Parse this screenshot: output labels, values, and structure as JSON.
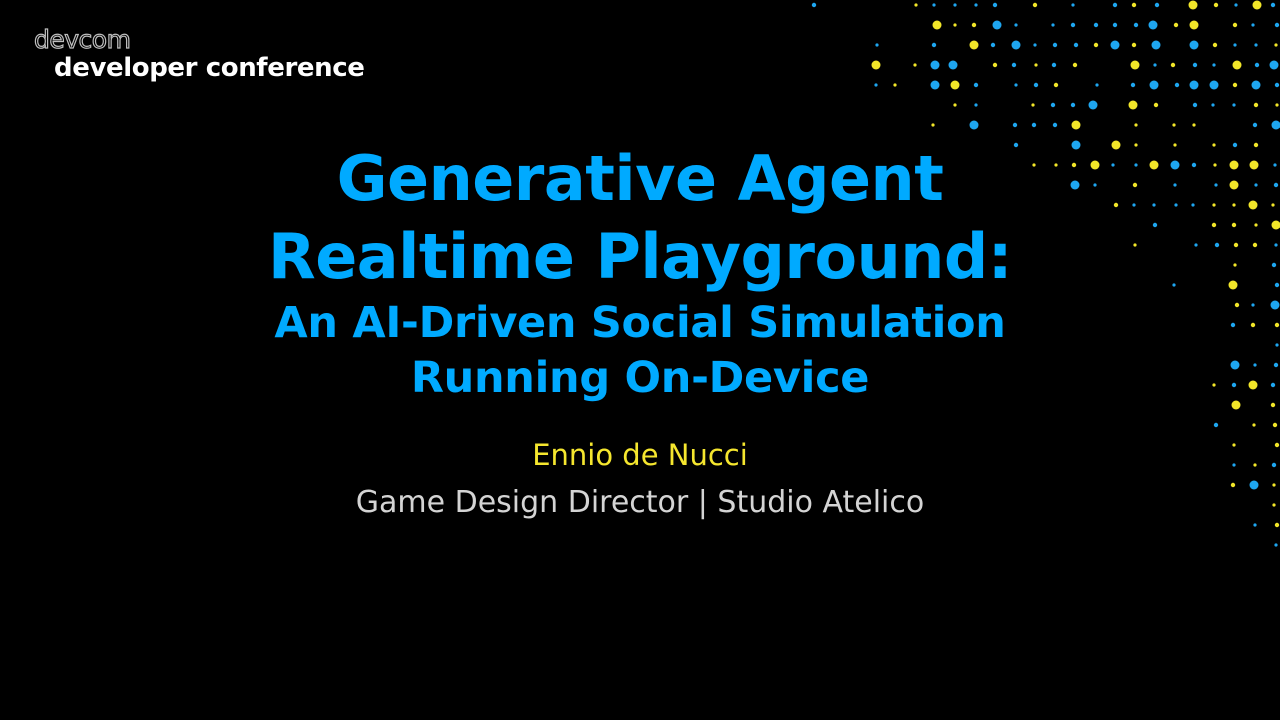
{
  "conference": {
    "logo_wordmark": "devcom",
    "tagline": "developer conference"
  },
  "talk": {
    "title_line_1": "Generative Agent",
    "title_line_2": "Realtime Playground:",
    "subtitle_line_1": "An AI-Driven Social Simulation",
    "subtitle_line_2": "Running On-Device"
  },
  "speaker": {
    "name": "Ennio de Nucci",
    "role": "Game Design Director | Studio Atelico"
  },
  "colors": {
    "background": "#000000",
    "title": "#00aaff",
    "speaker_name": "#f5e62e",
    "speaker_role": "#d4d4d4",
    "dot_blue": "#1ea6f0",
    "dot_yellow": "#f2e629"
  }
}
